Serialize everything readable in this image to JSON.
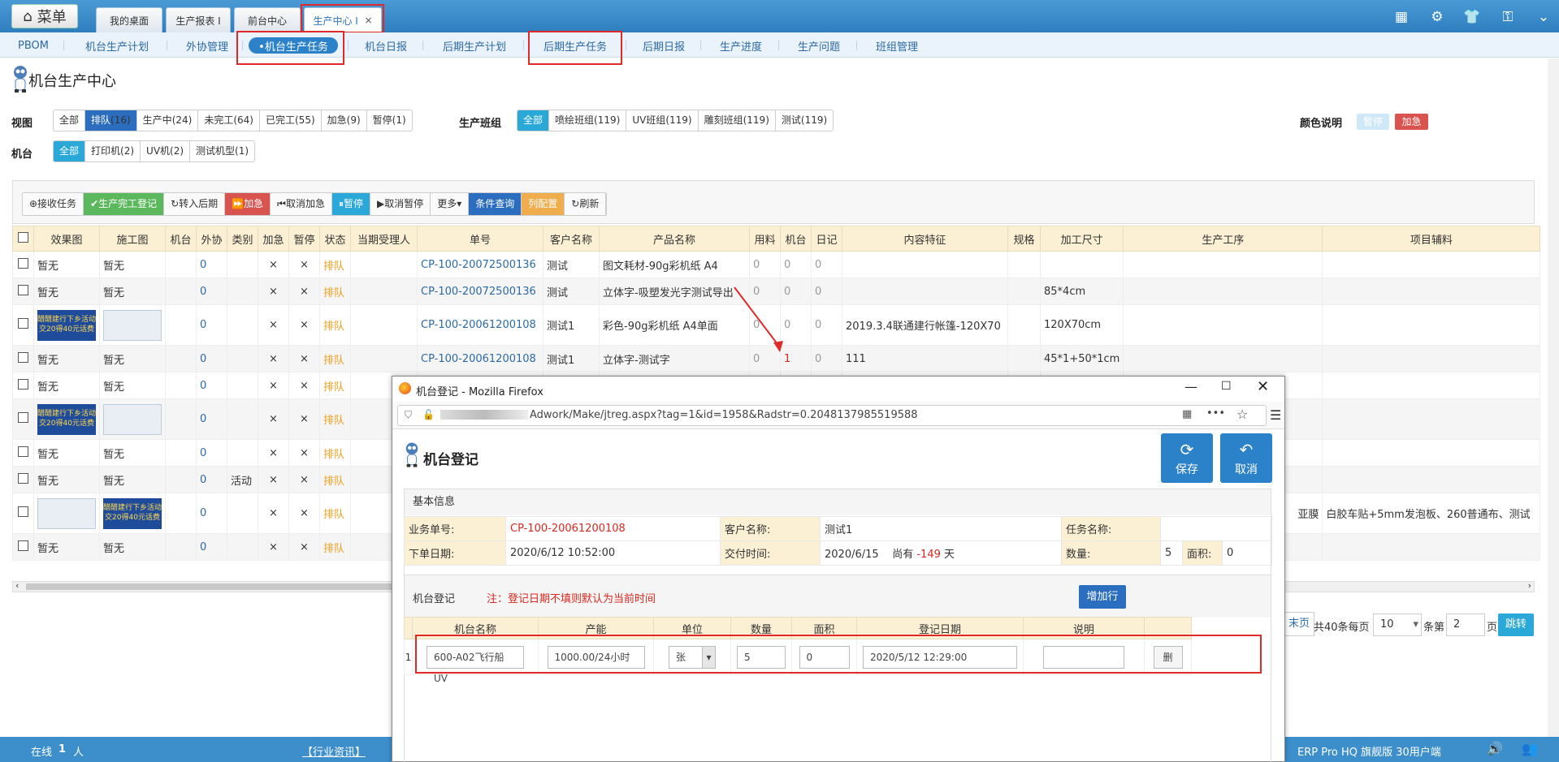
{
  "topbar": {
    "menu_label": "菜单",
    "tabs": [
      "我的桌面",
      "生产报表 I",
      "前台中心",
      "生产中心 I"
    ],
    "close": "×"
  },
  "subnav": [
    "PBOM",
    "机台生产计划",
    "外协管理",
    "•机台生产任务",
    "机台日报",
    "后期生产计划",
    "后期生产任务",
    "后期日报",
    "生产进度",
    "生产问题",
    "班组管理"
  ],
  "page_title": "机台生产中心",
  "view": {
    "label": "视图",
    "items": [
      {
        "t": "全部"
      },
      {
        "t": "排队",
        "c": "(16)"
      },
      {
        "t": "生产中",
        "c": "(24)"
      },
      {
        "t": "未完工",
        "c": "(64)"
      },
      {
        "t": "已完工",
        "c": "(55)"
      },
      {
        "t": "加急",
        "c": "(9)"
      },
      {
        "t": "暂停",
        "c": "(1)"
      }
    ]
  },
  "team": {
    "label": "生产班组",
    "items": [
      {
        "t": "全部"
      },
      {
        "t": "喷绘班组",
        "c": "(119)"
      },
      {
        "t": "UV班组",
        "c": "(119)"
      },
      {
        "t": "雕刻班组",
        "c": "(119)"
      },
      {
        "t": "测试",
        "c": "(119)"
      }
    ]
  },
  "color_legend": {
    "label": "颜色说明",
    "pause": "暂停",
    "urgent": "加急"
  },
  "machine": {
    "label": "机台",
    "items": [
      {
        "t": "全部"
      },
      {
        "t": "打印机",
        "c": "(2)"
      },
      {
        "t": "UV机",
        "c": "(2)"
      },
      {
        "t": "测试机型",
        "c": "(1)"
      }
    ]
  },
  "toolbar": [
    "⊕接收任务",
    "✔生产完工登记",
    "↻转入后期",
    "⏩加急",
    "⏮取消加急",
    "⏸暂停",
    "▶取消暂停",
    "更多▾",
    "条件查询",
    "列配置",
    "↻刷新"
  ],
  "table": {
    "headers": [
      "效果图",
      "施工图",
      "机台",
      "外协",
      "类别",
      "加急",
      "暂停",
      "状态",
      "当期受理人",
      "单号",
      "客户名称",
      "产品名称",
      "用料",
      "机台",
      "日记",
      "内容特征",
      "规格",
      "加工尺寸",
      "生产工序",
      "项目辅料"
    ],
    "rows": [
      {
        "eff": "暂无",
        "con": "暂无",
        "out": "0",
        "type": "",
        "urg": "×",
        "pause": "×",
        "status": "排队",
        "no": "CP-100-20072500136",
        "cust": "测试",
        "prod": "图文耗材-90g彩机纸 A4",
        "mat": "0",
        "mach": "0",
        "diary": "0",
        "feat": "",
        "spec": "",
        "size": "",
        "proc": "",
        "aux": ""
      },
      {
        "eff": "暂无",
        "con": "暂无",
        "out": "0",
        "type": "",
        "urg": "×",
        "pause": "×",
        "status": "排队",
        "no": "CP-100-20072500136",
        "cust": "测试",
        "prod": "立体字-吸塑发光字测试导出",
        "mat": "0",
        "mach": "0",
        "diary": "0",
        "feat": "",
        "spec": "",
        "size": "85*4cm",
        "proc": "",
        "aux": ""
      },
      {
        "eff": "",
        "con": "",
        "out": "0",
        "type": "",
        "urg": "×",
        "pause": "×",
        "status": "排队",
        "no": "CP-100-20061200108",
        "cust": "测试1",
        "prod": "彩色-90g彩机纸 A4单面",
        "mat": "0",
        "mach": "0",
        "diary": "0",
        "feat": "2019.3.4联通建行帐篷-120X70",
        "spec": "",
        "size": "120X70cm",
        "proc": "",
        "aux": ""
      },
      {
        "eff": "暂无",
        "con": "暂无",
        "out": "0",
        "type": "",
        "urg": "×",
        "pause": "×",
        "status": "排队",
        "no": "CP-100-20061200108",
        "cust": "测试1",
        "prod": "立体字-测试字",
        "mat": "0",
        "mach": "1",
        "diary": "0",
        "feat": "111",
        "spec": "",
        "size": "45*1+50*1cm",
        "proc": "",
        "aux": ""
      },
      {
        "eff": "暂无",
        "con": "暂无",
        "out": "0",
        "type": "",
        "urg": "×",
        "pause": "×",
        "status": "排队",
        "no": "",
        "cust": "",
        "prod": "",
        "mat": "",
        "mach": "",
        "diary": "",
        "feat": "",
        "spec": "",
        "size": "",
        "proc": "",
        "aux": ""
      },
      {
        "eff": "",
        "con": "",
        "out": "0",
        "type": "",
        "urg": "×",
        "pause": "×",
        "status": "排队",
        "no": "",
        "cust": "",
        "prod": "",
        "mat": "",
        "mach": "",
        "diary": "",
        "feat": "",
        "spec": "",
        "size": "",
        "proc": "",
        "aux": ""
      },
      {
        "eff": "暂无",
        "con": "暂无",
        "out": "0",
        "type": "",
        "urg": "×",
        "pause": "×",
        "status": "排队",
        "no": "",
        "cust": "",
        "prod": "",
        "mat": "",
        "mach": "",
        "diary": "",
        "feat": "",
        "spec": "",
        "size": "",
        "proc": "",
        "aux": ""
      },
      {
        "eff": "暂无",
        "con": "暂无",
        "out": "0",
        "type": "活动",
        "urg": "×",
        "pause": "×",
        "status": "排队",
        "no": "",
        "cust": "",
        "prod": "",
        "mat": "",
        "mach": "",
        "diary": "",
        "feat": "",
        "spec": "",
        "size": "",
        "proc": "",
        "aux": ""
      },
      {
        "eff": "",
        "con": "",
        "out": "0",
        "type": "",
        "urg": "×",
        "pause": "×",
        "status": "排队",
        "no": "",
        "cust": "",
        "prod": "",
        "mat": "",
        "mach": "",
        "diary": "",
        "feat": "",
        "spec": "",
        "size": "",
        "proc": "亚膜",
        "aux": "白胶车贴+5mm发泡板、260普通布、测试"
      },
      {
        "eff": "暂无",
        "con": "暂无",
        "out": "0",
        "type": "",
        "urg": "×",
        "pause": "×",
        "status": "排队",
        "no": "",
        "cust": "",
        "prod": "",
        "mat": "",
        "mach": "",
        "diary": "",
        "feat": "",
        "spec": "",
        "size": "",
        "proc": "",
        "aux": ""
      }
    ],
    "ad_text": "醋醋建行下乡活动\n交20得40元话费"
  },
  "pager": {
    "last": "末页",
    "total": "共40条每页",
    "per_page": "10",
    "unit": "条第",
    "page": "2",
    "page_unit": "页",
    "jump": "跳转"
  },
  "status": {
    "online": "在线",
    "count": "1",
    "person": "人",
    "news": "【行业资讯】",
    "product": "ERP Pro HQ 旗舰版 30用户端"
  },
  "popup": {
    "window_title": "机台登记 - Mozilla Firefox",
    "url": "Adwork/Make/jtreg.aspx?tag=1&id=1958&Radstr=0.2048137985519588",
    "heading": "机台登记",
    "save": "保存",
    "cancel": "取消",
    "basic": {
      "title": "基本信息",
      "order_k": "业务单号:",
      "order_v": "CP-100-20061200108",
      "cust_k": "客户名称:",
      "cust_v": "测试1",
      "task_k": "任务名称:",
      "task_v": "",
      "date_k": "下单日期:",
      "date_v": "2020/6/12 10:52:00",
      "deliv_k": "交付时间:",
      "deliv_v": "2020/6/15",
      "remain_pre": "尚有",
      "remain_num": "-149",
      "remain_unit": "天",
      "qty_k": "数量:",
      "qty_v": "5",
      "area_k": "面积:",
      "area_v": "0"
    },
    "reg": {
      "title": "机台登记",
      "note": "注：登记日期不填则默认为当前时间",
      "add": "增加行",
      "headers": [
        "机台名称",
        "产能",
        "单位",
        "数量",
        "面积",
        "登记日期",
        "说明"
      ],
      "row": {
        "idx": "1",
        "machine": "600-A02飞行船UV",
        "capacity": "1000.00/24小时",
        "unit": "张",
        "qty": "5",
        "area": "0",
        "date": "2020/5/12 12:29:00",
        "desc": "",
        "del": "删"
      }
    }
  },
  "colors": {
    "accent": "#2b82c9",
    "red": "#d9281e",
    "orange": "#f0a020"
  }
}
